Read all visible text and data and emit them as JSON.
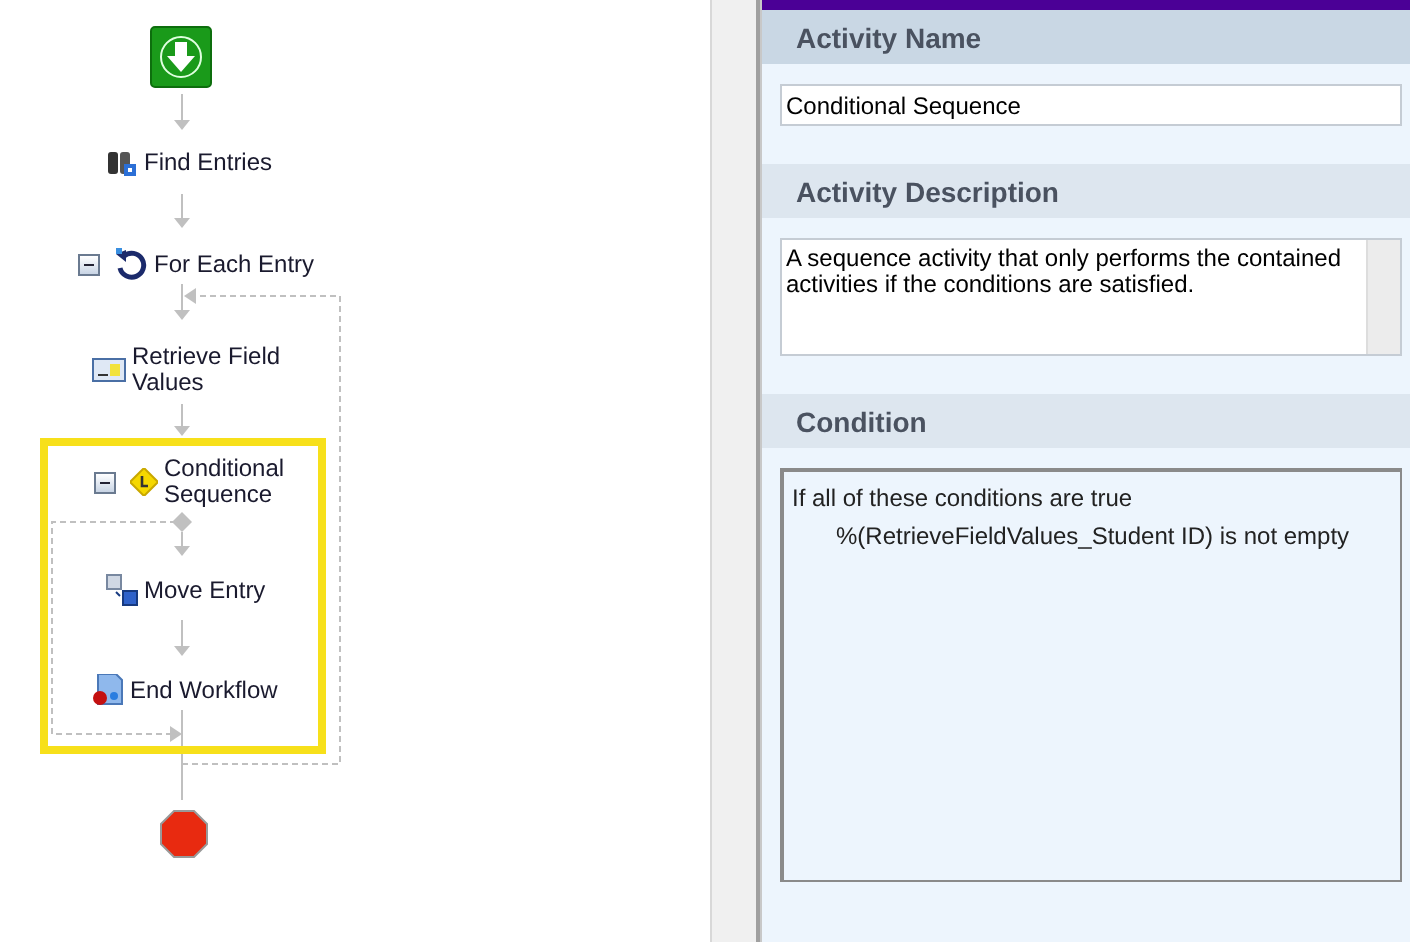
{
  "workflow": {
    "nodes": [
      {
        "kind": "start"
      },
      {
        "kind": "find",
        "label": "Find Entries"
      },
      {
        "kind": "loop",
        "label": "For Each Entry",
        "expanded": true
      },
      {
        "kind": "retrieve",
        "label": "Retrieve Field Values"
      },
      {
        "kind": "conditional",
        "label": "Conditional Sequence",
        "expanded": true,
        "selected": true
      },
      {
        "kind": "move",
        "label": "Move Entry"
      },
      {
        "kind": "end",
        "label": "End Workflow"
      },
      {
        "kind": "stop"
      }
    ]
  },
  "properties": {
    "sections": [
      {
        "title": "Activity Name",
        "selected": true,
        "kind": "text",
        "value": "Conditional Sequence"
      },
      {
        "title": "Activity Description",
        "selected": false,
        "kind": "textarea",
        "value": "A sequence activity that only performs the contained activities if the conditions are satisfied."
      },
      {
        "title": "Condition",
        "selected": false,
        "kind": "condition",
        "lines": [
          "If all of these conditions are true",
          "%(RetrieveFieldValues_Student ID) is not empty"
        ]
      }
    ]
  }
}
